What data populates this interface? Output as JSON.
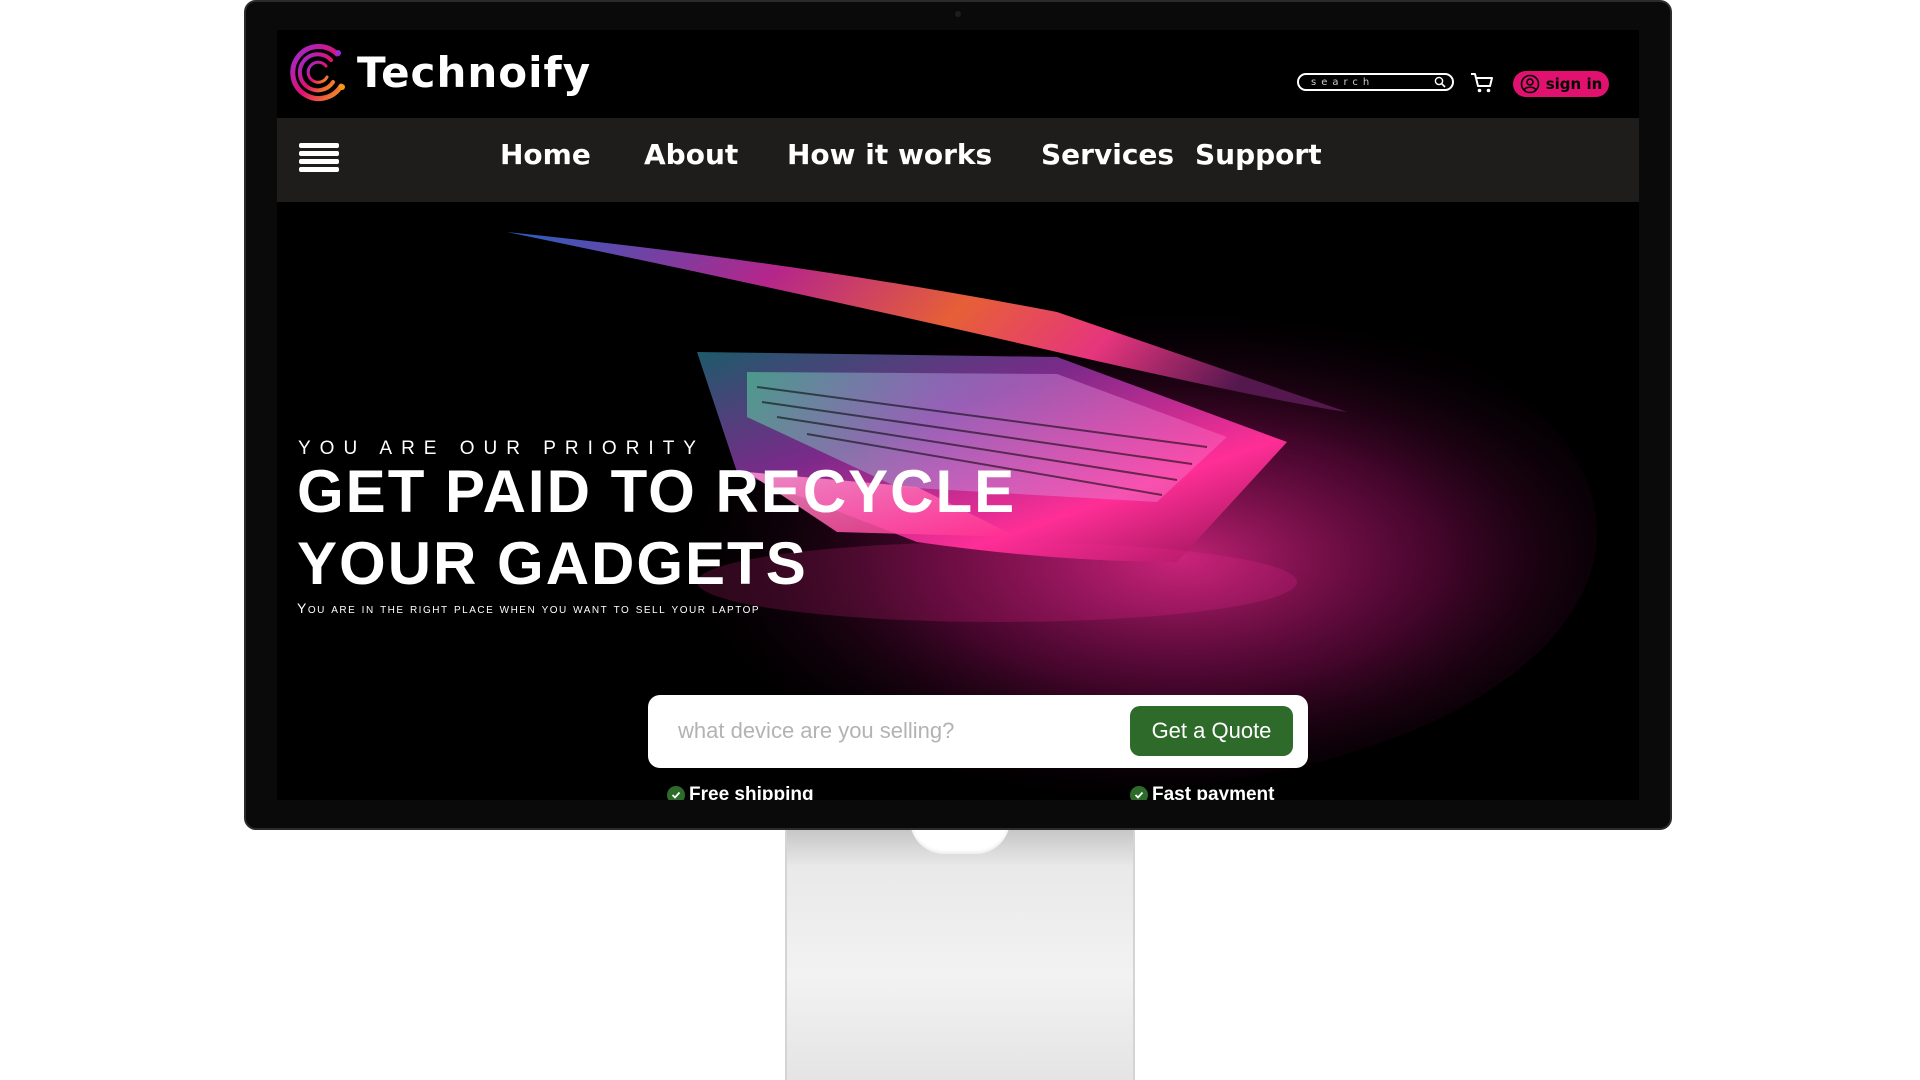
{
  "brand": {
    "name": "Technoify",
    "colors": {
      "accent": "#e0116f",
      "cta": "#2e6b2a",
      "nav_bg": "#1f1c1c"
    }
  },
  "header": {
    "search_placeholder": "search",
    "cart_icon": "cart-icon",
    "signin_label": "sign in",
    "signin_icon": "user-circle-icon"
  },
  "nav": {
    "menu_icon": "hamburger-icon",
    "items": [
      {
        "label": "Home"
      },
      {
        "label": "About"
      },
      {
        "label": "How it works"
      },
      {
        "label": "Services"
      },
      {
        "label": "Support"
      }
    ]
  },
  "hero": {
    "eyebrow": "YOU ARE OUR PRIORITY",
    "headline_line1": "GET PAID TO RECYCLE",
    "headline_line2": "YOUR GADGETS",
    "subline": "You are in the right place when you want to sell your laptop",
    "quote_placeholder": "what device are you selling?",
    "quote_button": "Get a Quote",
    "features": [
      {
        "label": "Free shipping"
      },
      {
        "label": "Fast payment"
      }
    ]
  }
}
